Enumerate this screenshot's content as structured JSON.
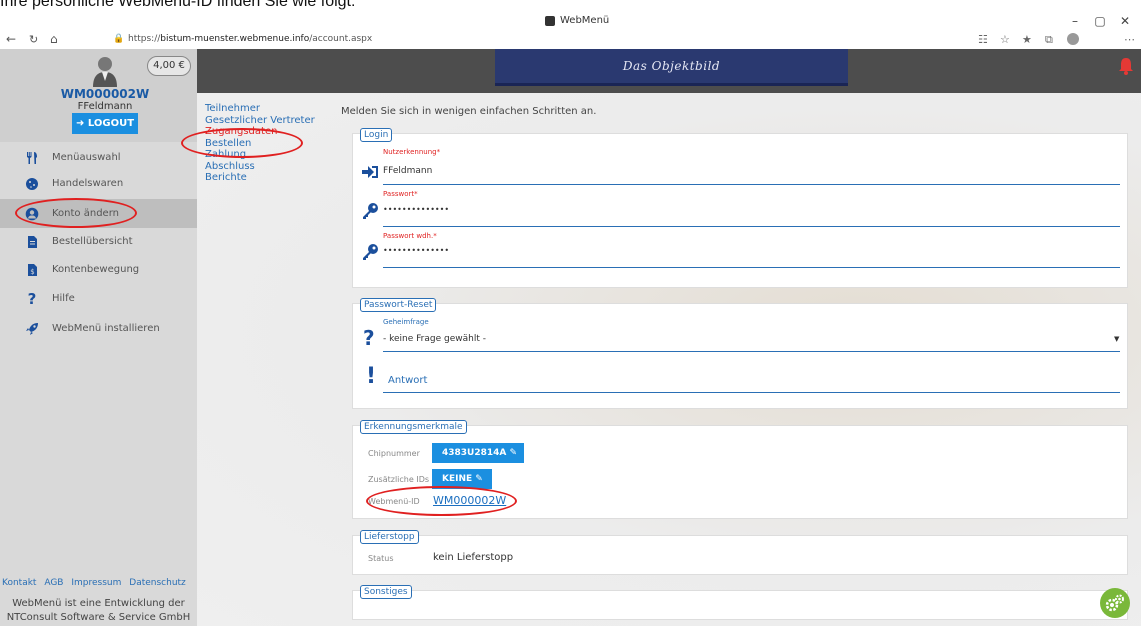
{
  "caption": "Ihre persönliche WebMenü-ID finden Sie wie folgt:",
  "browser": {
    "window_title": "WebMenü",
    "url_prefix": "https://",
    "url_host": "bistum-muenster.webmenue.info",
    "url_path": "/account.aspx"
  },
  "header": {
    "banner_text": "Das Objektbild"
  },
  "sidebar": {
    "balance": "4,00 €",
    "user_id": "WM000002W",
    "user_name": "FFeldmann",
    "logout_label": "LOGOUT",
    "items": [
      {
        "label": "Menüauswahl",
        "icon": "cutlery-icon"
      },
      {
        "label": "Handelswaren",
        "icon": "cookie-icon"
      },
      {
        "label": "Konto ändern",
        "icon": "user-circle-icon",
        "active": true
      },
      {
        "label": "Bestellübersicht",
        "icon": "document-icon"
      },
      {
        "label": "Kontenbewegung",
        "icon": "money-document-icon"
      },
      {
        "label": "Hilfe",
        "icon": "question-icon"
      },
      {
        "label": "WebMenü installieren",
        "icon": "rocket-icon"
      }
    ],
    "footer_links": [
      "Kontakt",
      "AGB",
      "Impressum",
      "Datenschutz"
    ],
    "footer_text_1": "WebMenü ist eine Entwicklung der",
    "footer_text_2": "NTConsult Software & Service GmbH"
  },
  "steps": [
    "Teilnehmer",
    "Gesetzlicher Vertreter",
    "Zugangsdaten",
    "Bestellen",
    "Zahlung",
    "Abschluss",
    "Berichte"
  ],
  "intro": "Melden Sie sich in wenigen einfachen Schritten an.",
  "login": {
    "legend": "Login",
    "username_label": "Nutzerkennung",
    "username_value": "FFeldmann",
    "password_label": "Passwort",
    "password_value": "••••••••••••••",
    "password_repeat_label": "Passwort wdh.",
    "password_repeat_value": "••••••••••••••",
    "required_mark": "*"
  },
  "password_reset": {
    "legend": "Passwort-Reset",
    "question_label": "Geheimfrage",
    "question_value": "- keine Frage gewählt -",
    "answer_placeholder": "Antwort"
  },
  "recognition": {
    "legend": "Erkennungsmerkmale",
    "chip_label": "Chipnummer",
    "chip_value": "4383U2814A",
    "extra_ids_label": "Zusätzliche IDs",
    "extra_ids_value": "KEINE",
    "webmenu_id_label": "Webmenü-ID",
    "webmenu_id_value": "WM000002W"
  },
  "delivery_stop": {
    "legend": "Lieferstopp",
    "status_label": "Status",
    "status_value": "kein Lieferstopp"
  },
  "misc": {
    "legend": "Sonstiges"
  },
  "colors": {
    "accent": "#1b8fe0",
    "link": "#2a6fb5",
    "highlight": "#e02020",
    "header": "#4d4d4d",
    "sidebar": "#d9d9d9"
  }
}
